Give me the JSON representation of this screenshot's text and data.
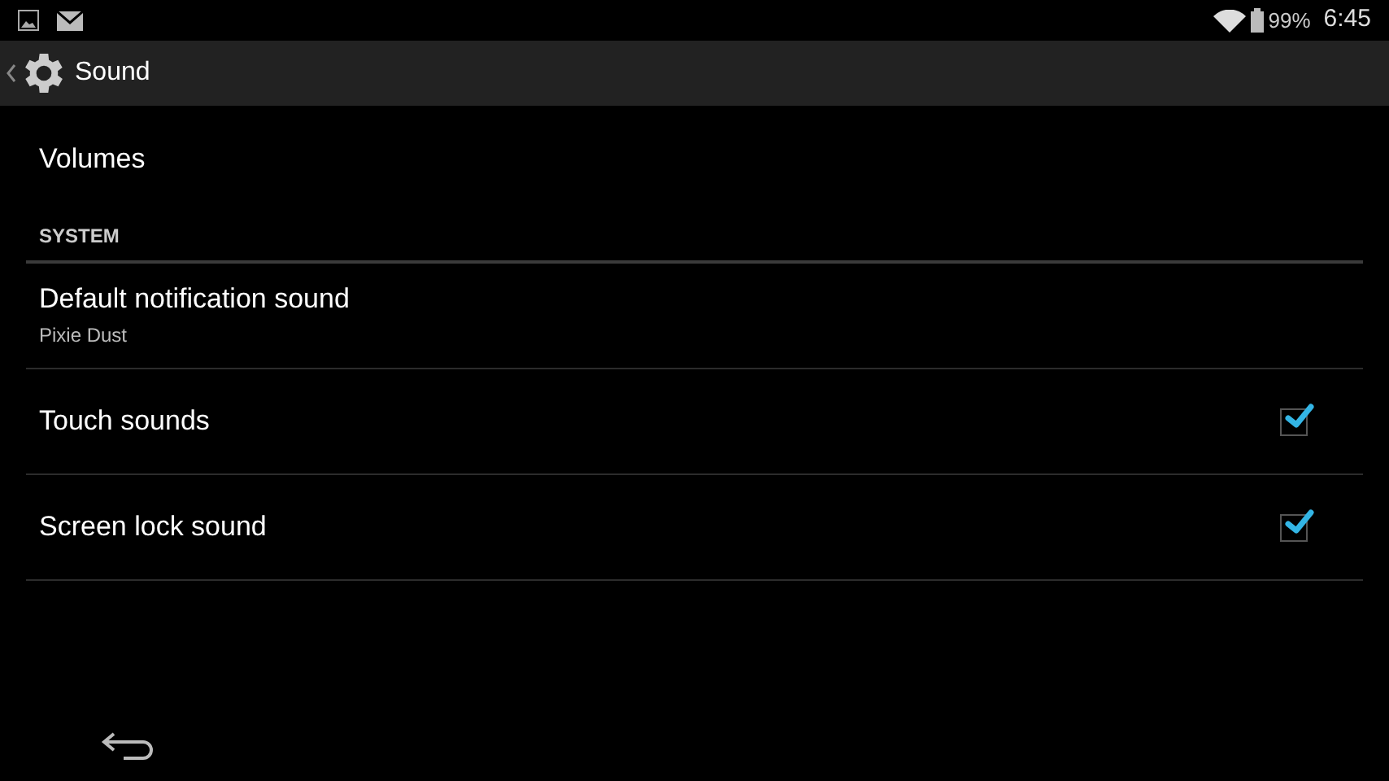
{
  "status_bar": {
    "battery": "99%",
    "time": "6:45"
  },
  "action_bar": {
    "title": "Sound"
  },
  "items": [
    {
      "kind": "text",
      "title": "Volumes"
    }
  ],
  "sections": [
    {
      "header": "SYSTEM",
      "items": [
        {
          "kind": "text",
          "title": "Default notification sound",
          "summary": "Pixie Dust"
        },
        {
          "kind": "checkbox",
          "title": "Touch sounds",
          "checked": true
        },
        {
          "kind": "checkbox",
          "title": "Screen lock sound",
          "checked": true
        }
      ]
    }
  ]
}
